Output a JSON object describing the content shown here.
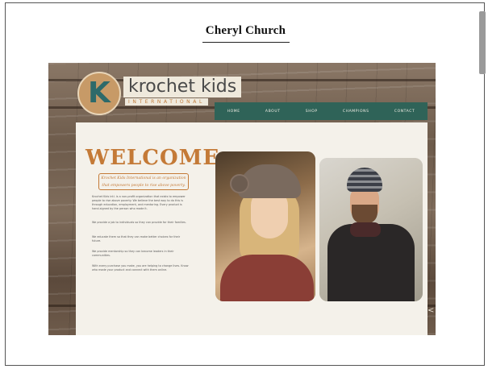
{
  "author": "Cheryl Church",
  "site": {
    "logo_letter": "K",
    "logo_word": "krochet kids",
    "logo_sub": "INTERNATIONAL",
    "nav": [
      "HOME",
      "ABOUT",
      "SHOP",
      "CHAMPIONS",
      "CONTACT"
    ],
    "welcome": "WELCOME",
    "tagline": "Krochet Kids International is an organization that empowers people to rise above poverty.",
    "paragraphs": [
      "Krochet Kids intl. is a non-profit organization that exists to empower people to rise above poverty. We believe the best way to do this is through education, employment, and mentoring. Every product is hand-signed by the person who made it.",
      "We provide a job to individuals so they can provide for their families.",
      "We educate them so that they can make better choices for their future.",
      "We provide mentorship so they can become leaders in their communities.",
      "With every purchase you make, you are helping to change lives. Know who made your product and connect with them online."
    ],
    "side_arrow": "<"
  },
  "colors": {
    "accent_orange": "#c47a37",
    "nav_green": "#2f6358",
    "logo_teal": "#2d6a6a"
  },
  "icons": {
    "scroll_thumb": "scrollbar-thumb"
  }
}
